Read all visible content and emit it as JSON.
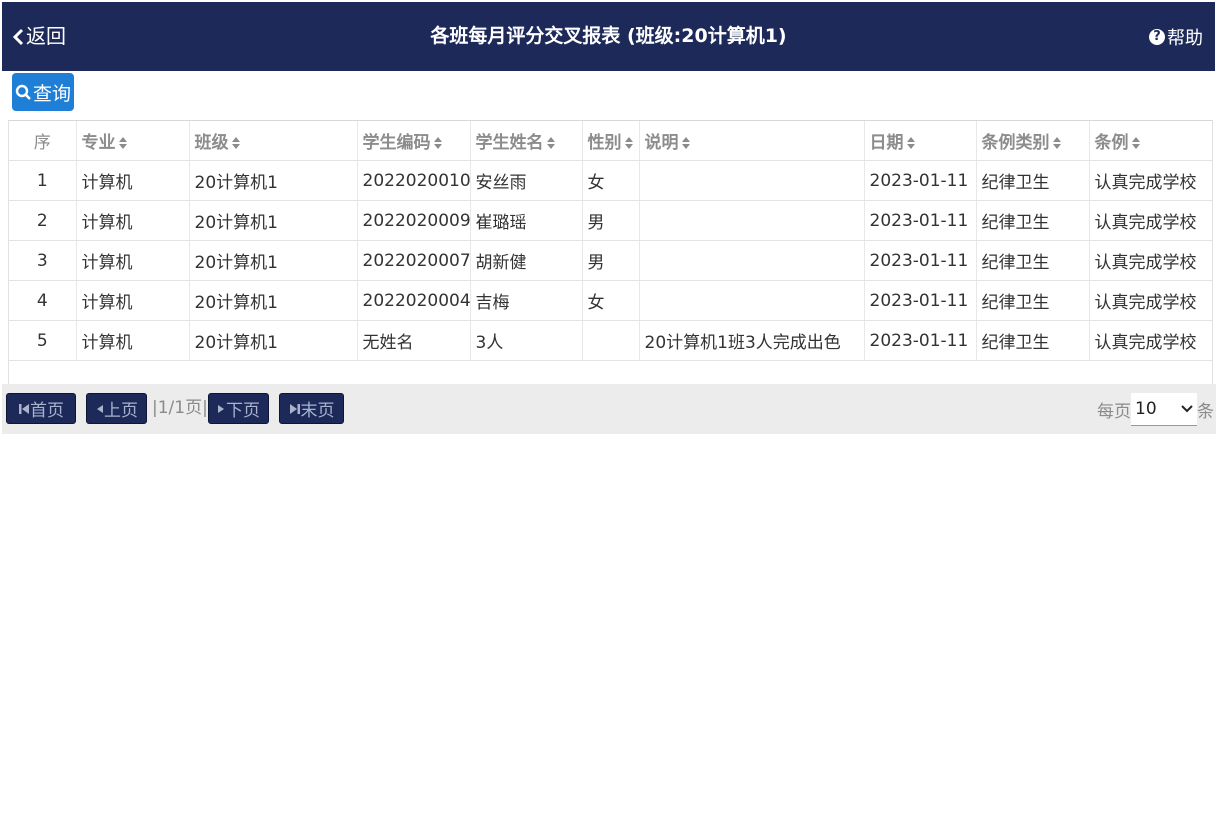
{
  "header": {
    "back_label": "返回",
    "title": "各班每月评分交叉报表 (班级:20计算机1)",
    "help_label": "帮助"
  },
  "toolbar": {
    "query_label": "查询"
  },
  "table": {
    "columns": [
      "序",
      "专业",
      "班级",
      "学生编码",
      "学生姓名",
      "性别",
      "说明",
      "日期",
      "条例类别",
      "条例"
    ],
    "rows": [
      [
        "1",
        "计算机",
        "20计算机1",
        "2022020010",
        "安丝雨",
        "女",
        "",
        "2023-01-11",
        "纪律卫生",
        "认真完成学校"
      ],
      [
        "2",
        "计算机",
        "20计算机1",
        "2022020009",
        "崔璐瑶",
        "男",
        "",
        "2023-01-11",
        "纪律卫生",
        "认真完成学校"
      ],
      [
        "3",
        "计算机",
        "20计算机1",
        "2022020007",
        "胡新健",
        "男",
        "",
        "2023-01-11",
        "纪律卫生",
        "认真完成学校"
      ],
      [
        "4",
        "计算机",
        "20计算机1",
        "2022020004",
        "吉梅",
        "女",
        "",
        "2023-01-11",
        "纪律卫生",
        "认真完成学校"
      ],
      [
        "5",
        "计算机",
        "20计算机1",
        "无姓名",
        "3人",
        "",
        "20计算机1班3人完成出色",
        "2023-01-11",
        "纪律卫生",
        "认真完成学校"
      ]
    ]
  },
  "pager": {
    "first_label": "首页",
    "prev_label": "上页",
    "page_info": "|1/1页|",
    "next_label": "下页",
    "last_label": "末页",
    "per_page_prefix": "每页",
    "per_page_value": "10",
    "per_page_suffix": "条"
  },
  "colors": {
    "header_bg": "#1d2a59",
    "query_bg": "#1f7fd6",
    "pager_bg": "#ececec"
  }
}
